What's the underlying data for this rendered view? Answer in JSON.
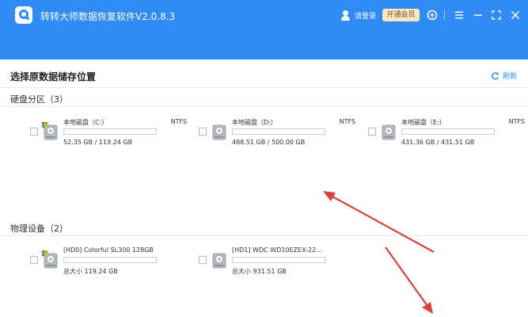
{
  "window": {
    "title": "转转大师数据恢复软件V2.0.8.3",
    "login_label": "请登录",
    "vip_button": "开通会员"
  },
  "toolbar_icons": [
    "logo-q-icon",
    "user-icon",
    "support-icon",
    "menu-icon",
    "minimize-icon",
    "maximize-icon",
    "close-icon"
  ],
  "page": {
    "title": "选择原数据储存位置",
    "refresh_label": "刷新"
  },
  "partitions": {
    "title": "硬盘分区（3）",
    "items": [
      {
        "name": "本地磁盘（C:）",
        "fs": "NTFS",
        "used_fraction": 0.56,
        "size": "52.35 GB / 119.24 GB",
        "windows_logo": true
      },
      {
        "name": "本地磁盘（D:）",
        "fs": "NTFS",
        "used_fraction": 0.02,
        "size": "488.51 GB / 500.00 GB",
        "windows_logo": false
      },
      {
        "name": "本地磁盘（E:）",
        "fs": "NTFS",
        "used_fraction": 0.0,
        "size": "431.36 GB / 431.51 GB",
        "windows_logo": false
      }
    ]
  },
  "devices": {
    "title": "物理设备（2）",
    "items": [
      {
        "name": "[HD0] Colorful SL300 128GB",
        "used_fraction": 1.0,
        "size": "总大小 119.24 GB",
        "windows_logo": true
      },
      {
        "name": "[HD1] WDC WD10EZEX-22MF...",
        "used_fraction": 1.0,
        "size": "总大小 931.51 GB",
        "windows_logo": false
      }
    ]
  },
  "colors": {
    "brand": "#2f8cf5",
    "bar_fill": "#1f86f0",
    "vip_bg": "#fbe7c2",
    "annotation_arrow": "#e0403a"
  }
}
